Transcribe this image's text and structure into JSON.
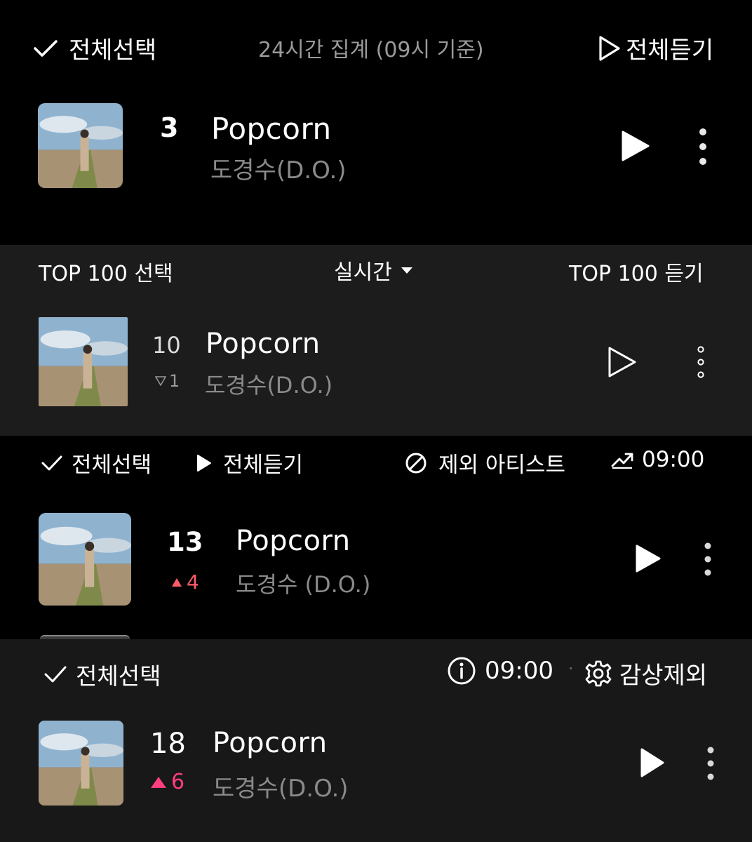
{
  "p1": {
    "select_all": "전체선택",
    "aggregate": "24시간 집계 (09시 기준)",
    "play_all": "전체듣기",
    "track": {
      "rank": "3",
      "title": "Popcorn",
      "artist": "도경수(D.O.)"
    }
  },
  "p2": {
    "top100_select": "TOP 100 선택",
    "mode": "실시간",
    "top100_play": "TOP 100 듣기",
    "track": {
      "rank": "10",
      "change": "1",
      "title": "Popcorn",
      "artist": "도경수(D.O.)"
    }
  },
  "p3": {
    "select_all": "전체선택",
    "play_all": "전체듣기",
    "exclude_artist": "제외 아티스트",
    "time": "09:00",
    "track": {
      "rank": "13",
      "change": "4",
      "title": "Popcorn",
      "artist": "도경수 (D.O.)"
    }
  },
  "p4": {
    "select_all": "전체선택",
    "time": "09:00",
    "separator": "·",
    "exclude": "감상제외",
    "track": {
      "rank": "18",
      "change": "6",
      "title": "Popcorn",
      "artist": "도경수(D.O.)"
    }
  },
  "colors": {
    "up_red": "#ff5a6a",
    "up_pink": "#ff3d7f",
    "artist_grey": "#8a8a8a"
  }
}
